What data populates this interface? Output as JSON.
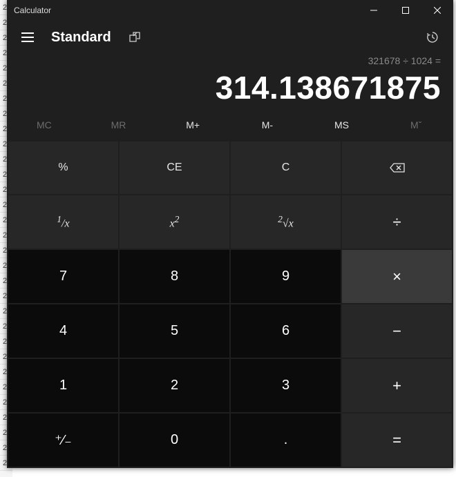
{
  "window": {
    "title": "Calculator"
  },
  "header": {
    "mode": "Standard"
  },
  "display": {
    "expression": "321678 ÷ 1024 =",
    "result": "314.138671875"
  },
  "memory": {
    "mc": "MC",
    "mr": "MR",
    "mplus": "M+",
    "mminus": "M-",
    "ms": "MS",
    "mlist": "Mˇ"
  },
  "keys": {
    "percent": "%",
    "ce": "CE",
    "c": "C",
    "reciprocal": "¹⁄ₓ",
    "square": "x²",
    "sqrt": "²√x",
    "divide": "÷",
    "seven": "7",
    "eight": "8",
    "nine": "9",
    "multiply": "×",
    "four": "4",
    "five": "5",
    "six": "6",
    "minus": "−",
    "one": "1",
    "two": "2",
    "three": "3",
    "plus": "+",
    "negate": "⁺⁄₋",
    "zero": "0",
    "decimal": ".",
    "equals": "="
  }
}
